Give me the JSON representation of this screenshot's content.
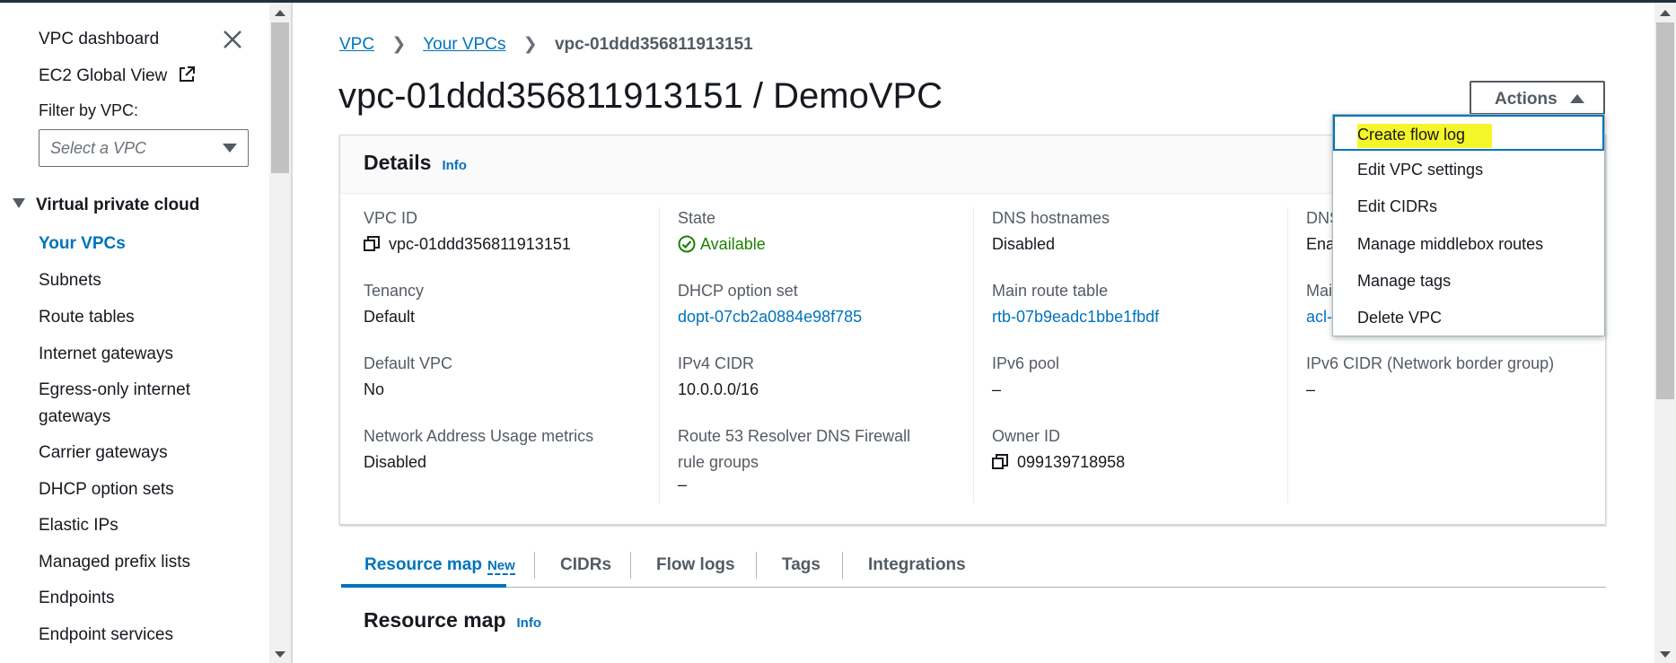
{
  "sidebar": {
    "dashboard_label": "VPC dashboard",
    "ec2_global_view_label": "EC2 Global View",
    "filter_label": "Filter by VPC:",
    "filter_placeholder": "Select a VPC",
    "section_title": "Virtual private cloud",
    "items": [
      {
        "label": "Your VPCs"
      },
      {
        "label": "Subnets"
      },
      {
        "label": "Route tables"
      },
      {
        "label": "Internet gateways"
      },
      {
        "label": "Egress-only internet"
      },
      {
        "label": "gateways"
      },
      {
        "label": "Carrier gateways"
      },
      {
        "label": "DHCP option sets"
      },
      {
        "label": "Elastic IPs"
      },
      {
        "label": "Managed prefix lists"
      },
      {
        "label": "Endpoints"
      },
      {
        "label": "Endpoint services"
      }
    ]
  },
  "breadcrumb": {
    "root": "VPC",
    "parent": "Your VPCs",
    "current": "vpc-01ddd356811913151"
  },
  "page_title": "vpc-01ddd356811913151 / DemoVPC",
  "actions_label": "Actions",
  "actions_menu": [
    "Create flow log",
    "Edit VPC settings",
    "Edit CIDRs",
    "Manage middlebox routes",
    "Manage tags",
    "Delete VPC"
  ],
  "details": {
    "title": "Details",
    "info": "Info",
    "col1": {
      "vpc_id_label": "VPC ID",
      "vpc_id": "vpc-01ddd356811913151",
      "tenancy_label": "Tenancy",
      "tenancy": "Default",
      "default_vpc_label": "Default VPC",
      "default_vpc": "No",
      "nau_label": "Network Address Usage metrics",
      "nau": "Disabled"
    },
    "col2": {
      "state_label": "State",
      "state": "Available",
      "dhcp_label": "DHCP option set",
      "dhcp": "dopt-07cb2a0884e98f785",
      "ipv4_label": "IPv4 CIDR",
      "ipv4": "10.0.0.0/16",
      "r53_label_1": "Route 53 Resolver DNS Firewall",
      "r53_label_2": "rule groups",
      "r53": "–"
    },
    "col3": {
      "dns_hostnames_label": "DNS hostnames",
      "dns_hostnames": "Disabled",
      "main_rt_label": "Main route table",
      "main_rt": "rtb-07b9eadc1bbe1fbdf",
      "ipv6_pool_label": "IPv6 pool",
      "ipv6_pool": "–",
      "owner_label": "Owner ID",
      "owner": "099139718958"
    },
    "col4": {
      "dns_label_partial": "DNS",
      "dns_value_partial": "Ena",
      "main_label_partial": "Mai",
      "main_value_partial": "acl-",
      "ipv6_cidr_label": "IPv6 CIDR (Network border group)",
      "ipv6_cidr": "–"
    }
  },
  "tabs": [
    {
      "label": "Resource map",
      "badge": "New"
    },
    {
      "label": "CIDRs"
    },
    {
      "label": "Flow logs"
    },
    {
      "label": "Tags"
    },
    {
      "label": "Integrations"
    }
  ],
  "resource_map": {
    "title": "Resource map",
    "info": "Info"
  },
  "colors": {
    "link": "#0073bb",
    "available": "#1d8102",
    "highlight": "#f5f52a"
  }
}
